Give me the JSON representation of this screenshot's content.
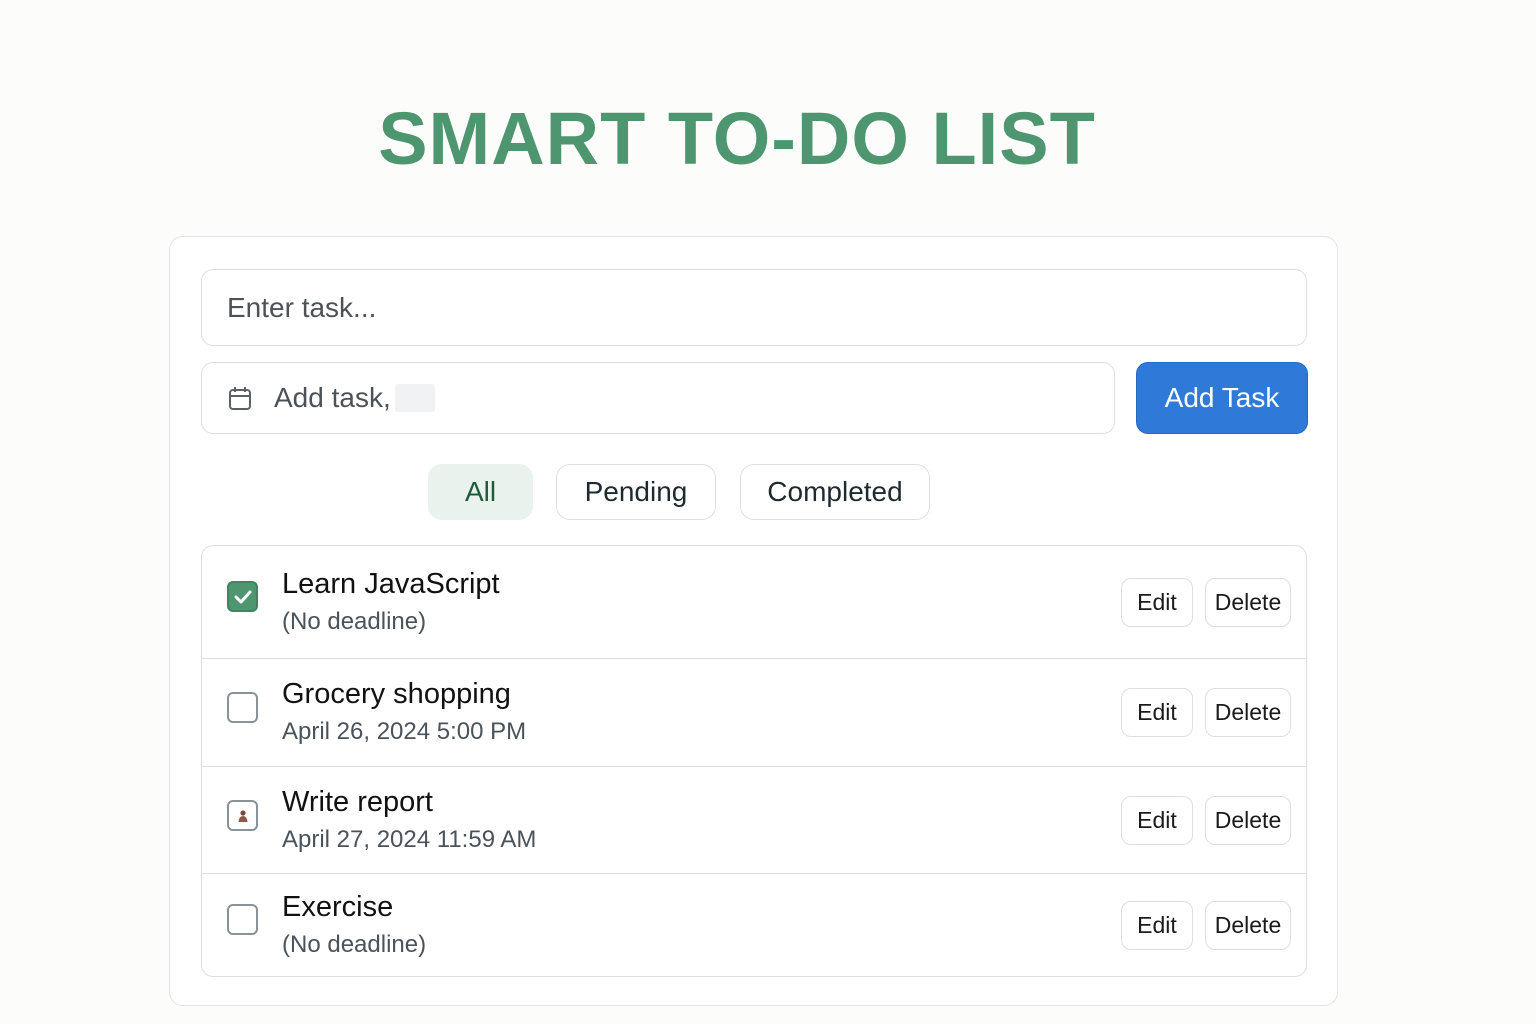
{
  "header": {
    "title": "SMART TO-DO LIST"
  },
  "form": {
    "task_placeholder": "Enter task...",
    "date_placeholder": "Add task,",
    "date_icon": "calendar-icon",
    "add_button": "Add Task"
  },
  "filters": [
    {
      "label": "All",
      "active": true
    },
    {
      "label": "Pending",
      "active": false
    },
    {
      "label": "Completed",
      "active": false
    }
  ],
  "tasks": [
    {
      "title": "Learn JavaScript",
      "deadline": "(No deadline)",
      "status": "checked",
      "edit_label": "Edit",
      "delete_label": "Delete"
    },
    {
      "title": "Grocery shopping",
      "deadline": "April 26, 2024  5:00 PM",
      "status": "unchecked",
      "edit_label": "Edit",
      "delete_label": "Delete"
    },
    {
      "title": "Write report",
      "deadline": "April 27, 2024  11:59 AM",
      "status": "flagged",
      "edit_label": "Edit",
      "delete_label": "Delete"
    },
    {
      "title": "Exercise",
      "deadline": "(No deadline)",
      "status": "unchecked",
      "edit_label": "Edit",
      "delete_label": "Delete"
    }
  ],
  "colors": {
    "accent_green": "#4e9670",
    "primary_blue": "#2f7ad8",
    "active_filter_bg": "#e9f2ec"
  }
}
